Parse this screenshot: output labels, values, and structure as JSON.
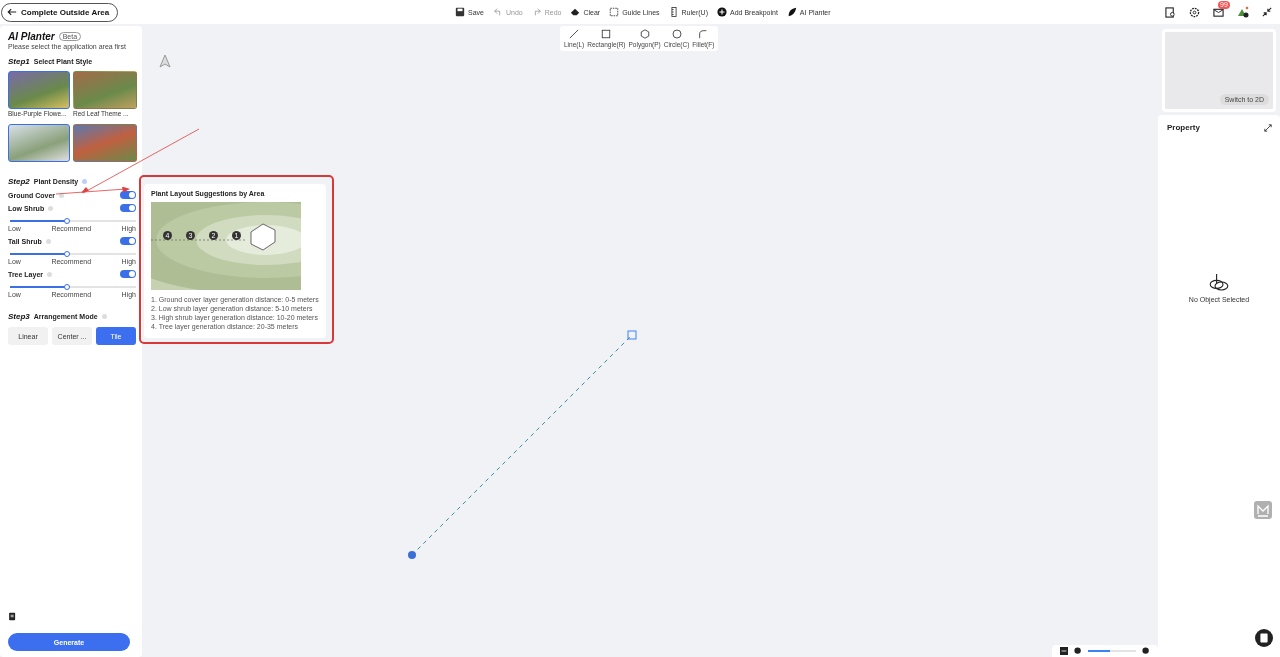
{
  "top_bar": {
    "back_label": "Complete Outside Area",
    "tools": [
      {
        "kind": "save",
        "label": "Save",
        "disabled": false
      },
      {
        "kind": "undo",
        "label": "Undo",
        "disabled": true
      },
      {
        "kind": "redo",
        "label": "Redo",
        "disabled": true
      },
      {
        "kind": "clear",
        "label": "Clear",
        "disabled": false
      },
      {
        "kind": "guide",
        "label": "Guide Lines",
        "disabled": false
      },
      {
        "kind": "ruler",
        "label": "Ruler(U)",
        "disabled": false
      },
      {
        "kind": "breakpoint",
        "label": "Add Breakpoint",
        "disabled": false
      },
      {
        "kind": "planter",
        "label": "AI Planter",
        "disabled": false
      }
    ],
    "mail_badge": "99"
  },
  "shape_tools": [
    {
      "kind": "line",
      "label": "Line(L)"
    },
    {
      "kind": "rect",
      "label": "Rectangle(R)"
    },
    {
      "kind": "polygon",
      "label": "Polygon(P)"
    },
    {
      "kind": "circle",
      "label": "Circle(C)"
    },
    {
      "kind": "fillet",
      "label": "Fillet(F)"
    }
  ],
  "planter": {
    "title": "AI Planter",
    "badge": "Beta",
    "subtitle": "Please select the application area first",
    "step1": {
      "step": "Step1",
      "label": "Select Plant Style"
    },
    "styles": [
      {
        "label": "Blue-Purple Flowe...",
        "selected": true
      },
      {
        "label": "Red Leaf Theme ...",
        "selected": false
      },
      {
        "selected": true
      },
      {
        "selected": false
      }
    ],
    "step2": {
      "step": "Step2",
      "label": "Plant Density"
    },
    "layers": [
      {
        "label": "Ground Cover",
        "on": true
      },
      {
        "label": "Low Shrub",
        "on": true,
        "level": 0.45,
        "low": "Low",
        "mid": "Recommend",
        "high": "High"
      },
      {
        "label": "Tall Shrub",
        "on": true,
        "level": 0.45,
        "low": "Low",
        "mid": "Recommend",
        "high": "High"
      },
      {
        "label": "Tree Layer",
        "on": true,
        "level": 0.45,
        "low": "Low",
        "mid": "Recommend",
        "high": "High"
      }
    ],
    "step3": {
      "step": "Step3",
      "label": "Arrangement Mode"
    },
    "modes": [
      {
        "label": "Linear",
        "selected": false
      },
      {
        "label": "Center ...",
        "selected": false
      },
      {
        "label": "Tile",
        "selected": true
      }
    ],
    "generate": "Generate"
  },
  "popover": {
    "title": "Plant Layout Suggestions by Area",
    "rings": [
      "4",
      "3",
      "2",
      "1"
    ],
    "items": [
      "1. Ground cover layer generation distance: 0-5 meters",
      "2. Low shrub layer generation distance: 5-10 meters",
      "3. High shrub layer generation distance: 10-20 meters",
      "4. Tree layer generation distance: 20-35 meters"
    ]
  },
  "preview": {
    "switch_label": "Switch to 2D"
  },
  "property": {
    "title": "Property",
    "empty": "No Object Selected"
  },
  "zoom": {
    "level": 0.45
  }
}
